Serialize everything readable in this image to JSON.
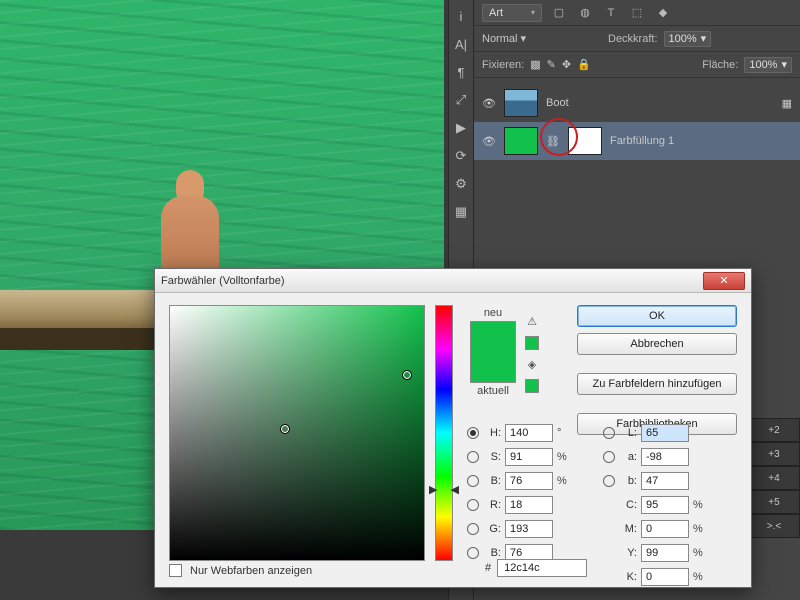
{
  "toolstrip": [
    "i",
    "A|",
    "¶",
    "⤢",
    "▶",
    "⟳",
    "⚙",
    "▦"
  ],
  "options": {
    "art_dropdown": "Art",
    "icons": [
      "▢",
      "◍",
      "T",
      "⬚",
      "◆"
    ],
    "blend": "Normal",
    "opacity_label": "Deckkraft:",
    "opacity_value": "100%",
    "lock_label": "Fixieren:",
    "fill_label": "Fläche:",
    "fill_value": "100%"
  },
  "layers": [
    {
      "name": "Boot"
    },
    {
      "name": "Farbfüllung 1"
    }
  ],
  "right_tabs": [
    "+2",
    "+3",
    "+4",
    "+5",
    ">.<"
  ],
  "dialog": {
    "title": "Farbwähler (Volltonfarbe)",
    "new_label": "neu",
    "current_label": "aktuell",
    "buttons": {
      "ok": "OK",
      "cancel": "Abbrechen",
      "add": "Zu Farbfeldern hinzufügen",
      "libs": "Farbbibliotheken"
    },
    "values": {
      "H": "140",
      "H_unit": "°",
      "S": "91",
      "S_unit": "%",
      "Bv": "76",
      "Bv_unit": "%",
      "R": "18",
      "G": "193",
      "B": "76",
      "L": "65",
      "a": "-98",
      "b": "47",
      "C": "95",
      "M": "0",
      "Y": "99",
      "K": "0",
      "hex": "12c14c"
    },
    "webonly": "Nur Webfarben anzeigen",
    "hash": "#"
  }
}
